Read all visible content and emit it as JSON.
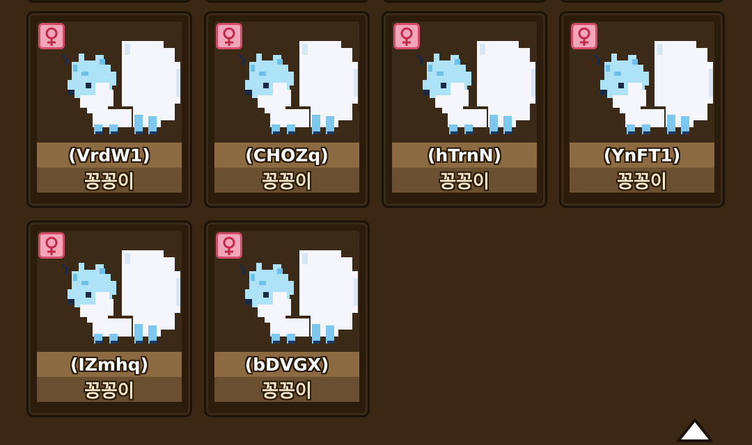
{
  "pets": [
    {
      "code": "(VrdW1)",
      "name": "꽁꽁이",
      "gender": "female"
    },
    {
      "code": "(CHOZq)",
      "name": "꽁꽁이",
      "gender": "female"
    },
    {
      "code": "(hTrnN)",
      "name": "꽁꽁이",
      "gender": "female"
    },
    {
      "code": "(YnFT1)",
      "name": "꽁꽁이",
      "gender": "female"
    },
    {
      "code": "(IZmhq)",
      "name": "꽁꽁이",
      "gender": "female"
    },
    {
      "code": "(bDVGX)",
      "name": "꽁꽁이",
      "gender": "female"
    }
  ],
  "icons": {
    "gender": "female-symbol-icon",
    "sprite": "ice-fox-sprite",
    "scroll": "arrow-up-icon"
  },
  "colors": {
    "background": "#3a2814",
    "card": "#2b1c0c",
    "label_top": "#8d6b42",
    "label_bottom": "#6a5030",
    "gender_fill": "#f2a6b8",
    "gender_border": "#d24c6a",
    "sprite_light": "#aee3f7",
    "sprite_white": "#f4f6fb"
  }
}
